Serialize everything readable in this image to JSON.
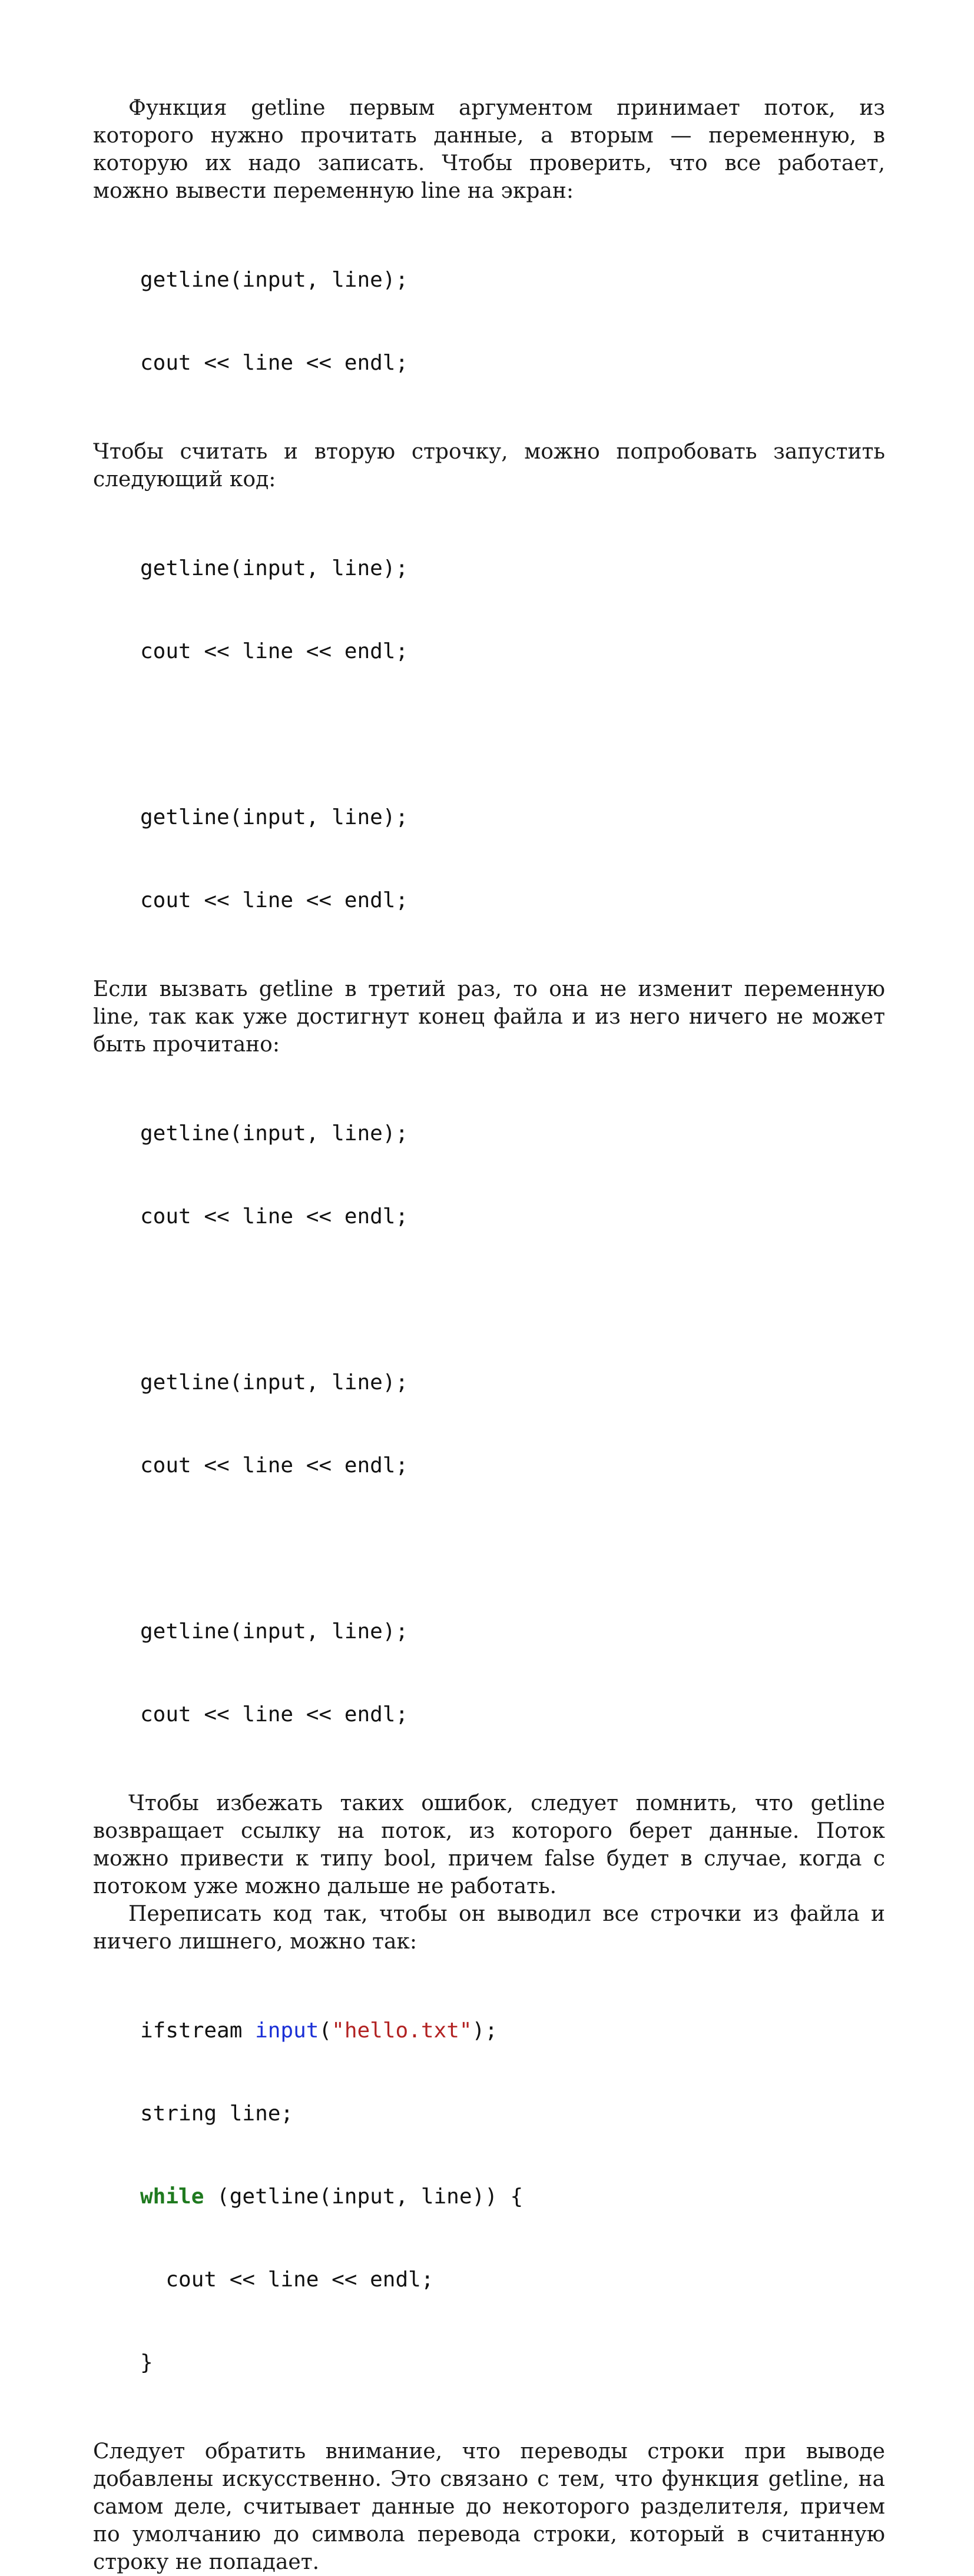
{
  "paragraphs": {
    "p1": "Функция getline первым аргументом принимает поток, из которого нужно прочитать данные, а вторым — переменную, в которую их надо записать. Чтобы проверить, что все работает, можно вывести переменную line на экран:",
    "p2": "Чтобы считать и вторую строчку, можно попробовать запустить следующий код:",
    "p3": "Если вызвать getline в третий раз, то она не изменит переменную line, так как уже достигнут конец файла и из него ничего не может быть прочитано:",
    "p4": "Чтобы избежать таких ошибок, следует помнить, что getline возвращает ссылку на поток, из которого берет данные. Поток можно привести к типу bool, причем false будет в случае, когда с потоком уже можно дальше не работать.",
    "p5": "Переписать код так, чтобы он выводил все строчки из файла и ничего лишнего, можно так:",
    "p6": "Следует обратить внимание, что переводы строки при выводе добавлены искусственно. Это связано с тем, что функция getline, на самом деле, считывает данные до некоторого разделителя, причем по умолчанию до символа перевода строки, который в считанную строку не попадает."
  },
  "code": {
    "getline_call": "getline(input, line);",
    "cout_call": "cout << line << endl;",
    "final": {
      "l1_a": "ifstream ",
      "l1_b": "input",
      "l1_c": "(",
      "l1_d": "\"hello.txt\"",
      "l1_e": ");",
      "l2": "string line;",
      "l3_a": "while",
      "l3_b": " (getline(input, line)) {",
      "l4": "  cout << line << endl;",
      "l5": "}"
    }
  },
  "colors": {
    "keyword": "#1f7a1f",
    "identifier": "#1a2fd6",
    "string": "#b22222"
  }
}
